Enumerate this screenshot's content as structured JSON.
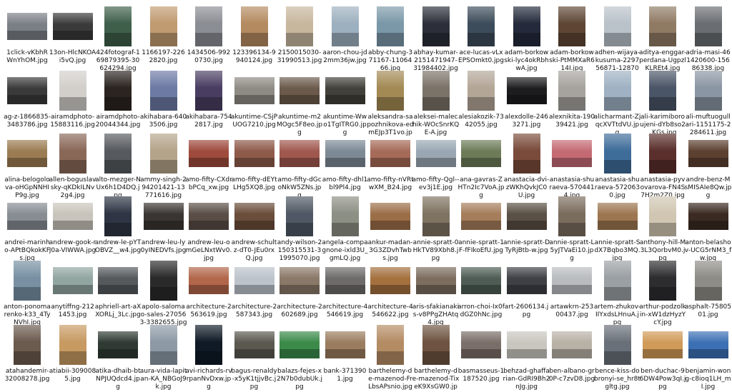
{
  "files": [
    {
      "name": "1click-vKbhRWnYhOM.jpg",
      "orientation": "landscape",
      "color": "#7a7f86"
    },
    {
      "name": "13on-HlcNKOAi5vQ.jpg",
      "orientation": "landscape",
      "color": "#3a3a3a"
    },
    {
      "name": "424fotograf-169879395-30624294.jpg",
      "orientation": "portrait",
      "color": "#3f5f4a"
    },
    {
      "name": "1166197-2262820.jpg",
      "orientation": "portrait",
      "color": "#c09a70"
    },
    {
      "name": "1434506-9920730.jpg",
      "orientation": "portrait",
      "color": "#8a8d93"
    },
    {
      "name": "123396134-9940124.jpg",
      "orientation": "portrait",
      "color": "#b48a60"
    },
    {
      "name": "2150015030-31990513.jpg",
      "orientation": "portrait",
      "color": "#c7b79d"
    },
    {
      "name": "aaron-chou-jd2mm36jw.jpg",
      "orientation": "portrait",
      "color": "#9db0bf"
    },
    {
      "name": "abby-chung-371167-1106466.jpg",
      "orientation": "portrait",
      "color": "#7a98a8"
    },
    {
      "name": "abhay-kumar-2151471947-31984402.jpg",
      "orientation": "portrait",
      "color": "#2c2f3a"
    },
    {
      "name": "ace-lucas-vLxEPSOmkt0.jpg",
      "orientation": "portrait",
      "color": "#3c4c5a"
    },
    {
      "name": "adam-borkowski-lyc4okRbhwA.jpg",
      "orientation": "portrait",
      "color": "#242a3b"
    },
    {
      "name": "adam-borkowski-PtMMXaR614I.jpg",
      "orientation": "portrait",
      "color": "#5e4634"
    },
    {
      "name": "adhen-wijaya-kusuma-229756871-12870445.jpg",
      "orientation": "portrait",
      "color": "#b9c2c9"
    },
    {
      "name": "aditya-enggar-perdana-UgpzlKLREt4.jpg",
      "orientation": "portrait",
      "color": "#8f7a63"
    },
    {
      "name": "adria-masi-461420600-15686338.jpg",
      "orientation": "portrait",
      "color": "#6a6e72"
    },
    {
      "name": "ag-z-1866835-3483786.jpg",
      "orientation": "landscape",
      "color": "#3a3a3a"
    },
    {
      "name": "airamdphoto-15883116.jpg",
      "orientation": "portrait",
      "color": "#d2cfcb"
    },
    {
      "name": "airamdphoto-20044344.jpg",
      "orientation": "portrait",
      "color": "#2b2420"
    },
    {
      "name": "akihabara-6403506.jpg",
      "orientation": "portrait",
      "color": "#6c7aa4"
    },
    {
      "name": "akihabara-7542817.jpg",
      "orientation": "portrait",
      "color": "#4a3d62"
    },
    {
      "name": "akuntime-CSjPUOG7210.jpg",
      "orientation": "landscape",
      "color": "#8e8a84"
    },
    {
      "name": "akuntime-m2MOgc5F8eo.jpg",
      "orientation": "landscape",
      "color": "#6b5a4b"
    },
    {
      "name": "akuntime-Wwo1TgITRG0.jpg",
      "orientation": "landscape",
      "color": "#42403a"
    },
    {
      "name": "aleksandra-sapozhnikova-edmEJp3T1vo.jpg",
      "orientation": "portrait",
      "color": "#a38a54"
    },
    {
      "name": "aleksei-malechik-WOcSnrKQE-A.jpg",
      "orientation": "portrait",
      "color": "#7b7268"
    },
    {
      "name": "alesiakozik-7342055.jpg",
      "orientation": "portrait",
      "color": "#b3a697"
    },
    {
      "name": "alexdolle-2463271.jpg",
      "orientation": "landscape",
      "color": "#1d1d1f"
    },
    {
      "name": "alexnikita-19039421.jpg",
      "orientation": "portrait",
      "color": "#a6a39e"
    },
    {
      "name": "alicharmant-ZjqcXVTtdVU.jpg",
      "orientation": "portrait",
      "color": "#9fb1c2"
    },
    {
      "name": "ali-karimiboroujeni-dYb8so2_KGs.jpg",
      "orientation": "portrait",
      "color": "#4a5567"
    },
    {
      "name": "ali-muftuogullari-1151175-2284611.jpg",
      "orientation": "portrait",
      "color": "#8a96a3"
    },
    {
      "name": "alina-belogolova-oHGpNNHIP9g.jpg",
      "orientation": "landscape",
      "color": "#9b7c52"
    },
    {
      "name": "allen-boguslavsky-qKDkILNv2g4.jpg",
      "orientation": "portrait",
      "color": "#8a6858"
    },
    {
      "name": "alto-mezger-NUx6h1D4DQ.jpg",
      "orientation": "portrait",
      "color": "#565a5e"
    },
    {
      "name": "ammy-singh-294201421-13771616.jpg",
      "orientation": "portrait",
      "color": "#b4a48a"
    },
    {
      "name": "amo-fifty-CXdrbPCq_xw.jpg",
      "orientation": "landscape",
      "color": "#9e4a3c"
    },
    {
      "name": "amo-fifty-dEYtLHg5XQ8.jpg",
      "orientation": "landscape",
      "color": "#8e5a4a"
    },
    {
      "name": "amo-fifty-dGcoNkW5ZNs.jpg",
      "orientation": "landscape",
      "color": "#a0584e"
    },
    {
      "name": "amo-fifty-dhl1bl9Pl4.jpg",
      "orientation": "landscape",
      "color": "#7d8a96"
    },
    {
      "name": "amo-fifty-nVRtwXM_B24.jpg",
      "orientation": "landscape",
      "color": "#a66a58"
    },
    {
      "name": "amo-fifty-Qgl--ev3j1E.jpg",
      "orientation": "landscape",
      "color": "#9aa7b3"
    },
    {
      "name": "ana-gavras-ZHTn2Ic7VoA.jpg",
      "orientation": "landscape",
      "color": "#6d7b58"
    },
    {
      "name": "anastacia-dvi-zWKhQvkJC0U.jpg",
      "orientation": "portrait",
      "color": "#7a4b3a"
    },
    {
      "name": "anastasia-shuraeva-5704414.jpg",
      "orientation": "landscape",
      "color": "#c46a73"
    },
    {
      "name": "anastasia-shuraeva-5720630.jpg",
      "orientation": "portrait",
      "color": "#3f6d9a"
    },
    {
      "name": "anastasia-pyvovarova-FN4S7H2m2Z0.jpg",
      "orientation": "portrait",
      "color": "#5a2f2c"
    },
    {
      "name": "andre-benz-MsMISAIe8Qw.jpg",
      "orientation": "landscape",
      "color": "#5c4030"
    },
    {
      "name": "andrei-marinho-APtBQkokKFs.jpg",
      "orientation": "landscape",
      "color": "#878d93"
    },
    {
      "name": "andrew-gook-rJ0a-VIWWA.jpg",
      "orientation": "landscape",
      "color": "#c8c4bb"
    },
    {
      "name": "andrew-le-pYTOBVZ__w4.jpg",
      "orientation": "portrait",
      "color": "#2e3544"
    },
    {
      "name": "andrew-leu-ly0yINEDVfs.jpg",
      "orientation": "landscape",
      "color": "#3a3532"
    },
    {
      "name": "andrew-leu-omGeLNxtWv0.jpg",
      "orientation": "landscape",
      "color": "#5a4d46"
    },
    {
      "name": "andrew-schultz-dT0-JEu0rxQ.jpg",
      "orientation": "landscape",
      "color": "#6a4d3a"
    },
    {
      "name": "andy-wilson-2150315531-31995070.jpg",
      "orientation": "portrait",
      "color": "#4f5864"
    },
    {
      "name": "angela-compagnone-ixld3U_gmLQ.jpg",
      "orientation": "portrait",
      "color": "#8c8f84"
    },
    {
      "name": "ankur-madan-3G3ZDvhTwbs.jpg",
      "orientation": "landscape",
      "color": "#9b6e48"
    },
    {
      "name": "annie-spratt-0HkTV89Xbh8.jpg",
      "orientation": "portrait",
      "color": "#7f7361"
    },
    {
      "name": "annie-spratt-1F-fFIkoEfU.jpg",
      "orientation": "landscape",
      "color": "#a57d5a"
    },
    {
      "name": "annie-spratt-DTyRjBtb-w.jpg",
      "orientation": "landscape",
      "color": "#5a5045"
    },
    {
      "name": "annie-spratt-L5yJTVaEi10.jpg",
      "orientation": "portrait",
      "color": "#7b6d5e"
    },
    {
      "name": "annie-spratt-SdX7Bqbo3MQ.jpg",
      "orientation": "landscape",
      "color": "#9c7650"
    },
    {
      "name": "anthony-hill-M3L3QorbvM0.jpg",
      "orientation": "portrait",
      "color": "#d0c6b2"
    },
    {
      "name": "anton-belashov-UCG5rNM3_fw.jpg",
      "orientation": "landscape",
      "color": "#3b2a22"
    },
    {
      "name": "anton-ponomarenko-k33_4TyNVhI.jpg",
      "orientation": "portrait",
      "color": "#7890a2"
    },
    {
      "name": "anytiffng-2121453.jpg",
      "orientation": "landscape",
      "color": "#91a6a0"
    },
    {
      "name": "aphriell-art-aXXORLj_3Lc.jpg",
      "orientation": "landscape",
      "color": "#55595c"
    },
    {
      "name": "apolo-salomao-sales-270563-3382655.jpg",
      "orientation": "portrait",
      "color": "#2a2a2a"
    },
    {
      "name": "architecture-2563619.jpg",
      "orientation": "landscape",
      "color": "#b2664a"
    },
    {
      "name": "architecture-2587343.jpg",
      "orientation": "landscape",
      "color": "#bcc3cb"
    },
    {
      "name": "architecture-2602689.jpg",
      "orientation": "landscape",
      "color": "#8a7868"
    },
    {
      "name": "architecture-4546619.jpg",
      "orientation": "landscape",
      "color": "#6d6b6a"
    },
    {
      "name": "architecture-4546622.jpg",
      "orientation": "landscape",
      "color": "#a4703e"
    },
    {
      "name": "aris-sfakianakis-v8PPgZHAtq4.jpg",
      "orientation": "landscape",
      "color": "#7c6d5f"
    },
    {
      "name": "arron-choi-Ix0fdGZ0hNc.jpg",
      "orientation": "landscape",
      "color": "#4e5c54"
    },
    {
      "name": "art-2606134.jpg",
      "orientation": "landscape",
      "color": "#3e4046"
    },
    {
      "name": "artawkrn-25300437.jpg",
      "orientation": "landscape",
      "color": "#b9bcbf"
    },
    {
      "name": "artem-zhukov-IIYxdsLHnuA.jpg",
      "orientation": "portrait",
      "color": "#9ba0a4"
    },
    {
      "name": "arthur-podzolkin-xW1dzHyzYcY.jpg",
      "orientation": "portrait",
      "color": "#2d2d30"
    },
    {
      "name": "asphalt-7580501.jpg",
      "orientation": "portrait",
      "color": "#8e8c86"
    },
    {
      "name": "atahandemir-32008278.jpg",
      "orientation": "portrait",
      "color": "#6b5a4e"
    },
    {
      "name": "atiabii-3090085.jpg",
      "orientation": "portrait",
      "color": "#c79a62"
    },
    {
      "name": "atika-dhaib-btNPJUQdcd4.jpg",
      "orientation": "landscape",
      "color": "#2f3a33"
    },
    {
      "name": "aura-vida-lapitan-KA_NBGoJ9k.jpg",
      "orientation": "portrait",
      "color": "#8d9aa6"
    },
    {
      "name": "avi-richards-rvrpanNvDxw.jpg",
      "orientation": "portrait",
      "color": "#0f1a26"
    },
    {
      "name": "bagus-renaldy-x5yK1tjjvBc.jpg",
      "orientation": "landscape",
      "color": "#5a584f"
    },
    {
      "name": "balazs-fejes-x2N7b0dubUk.jpg",
      "orientation": "landscape",
      "color": "#3b8a4a"
    },
    {
      "name": "bank-3713901.jpg",
      "orientation": "landscape",
      "color": "#9a7c5e"
    },
    {
      "name": "barthelemy-de-mazenod-FrLbsAPsnio.jpg",
      "orientation": "portrait",
      "color": "#b48c64"
    },
    {
      "name": "barthelemy-de-mazenod-TixeK9XsGW0.jpg",
      "orientation": "portrait",
      "color": "#6e5440"
    },
    {
      "name": "basmasseus-1187520.jpg",
      "orientation": "landscape",
      "color": "#7a6e68"
    },
    {
      "name": "behzad-ghaffarian-GdRI9Bh2nJg.jpg",
      "orientation": "landscape",
      "color": "#c9c6c0"
    },
    {
      "name": "ben-albano-gr0P-c7zvD8.jpg",
      "orientation": "landscape",
      "color": "#b8b1a6"
    },
    {
      "name": "bence-kiss-dobronyi-se_hr8tgltg.jpg",
      "orientation": "portrait",
      "color": "#6a7079"
    },
    {
      "name": "ben-duchac-96DW4Pow3qI.jpg",
      "orientation": "landscape",
      "color": "#d09a58"
    },
    {
      "name": "benjamin-wong-c8ioq1LH_mI.jpg",
      "orientation": "landscape",
      "color": "#3c70b4"
    }
  ]
}
